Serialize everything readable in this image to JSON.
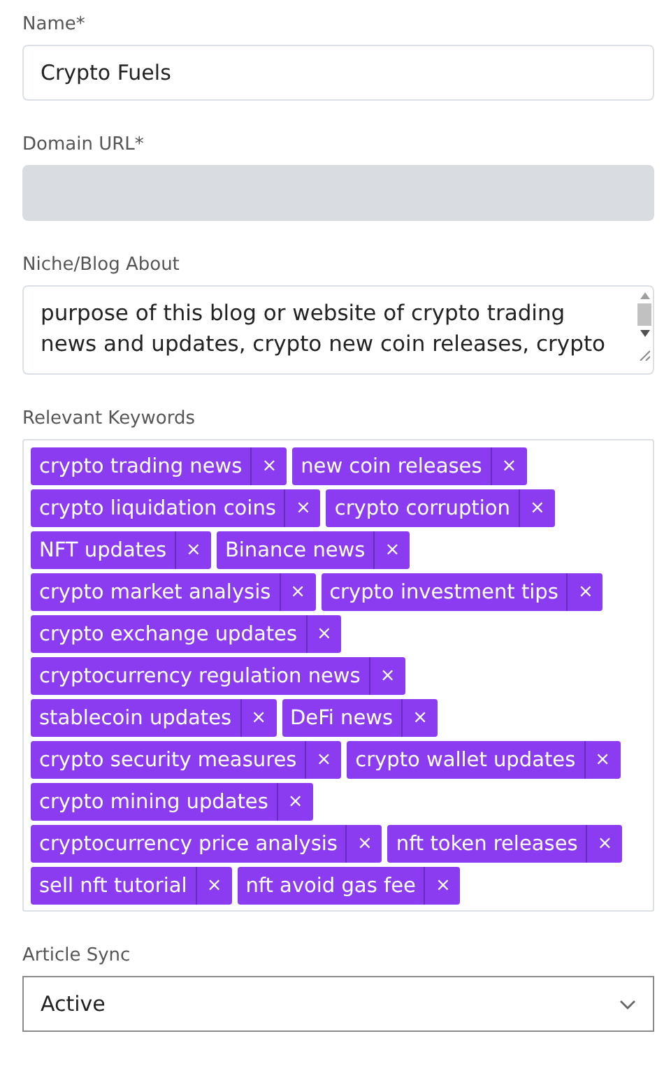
{
  "fields": [
    {
      "kind": "input",
      "label": "Name*",
      "value": "Crypto Fuels",
      "disabled": false
    },
    {
      "kind": "input",
      "label": "Domain URL*",
      "disabled": true
    },
    {
      "kind": "textarea",
      "label": "Niche/Blog About",
      "value": "purpose of this blog or website of crypto trading news and updates, crypto new coin releases, crypto"
    },
    {
      "kind": "tags",
      "label": "Relevant Keywords",
      "tags": [
        {
          "text": "crypto trading news",
          "remove": "×"
        },
        {
          "text": "new coin releases",
          "remove": "×"
        },
        {
          "text": "crypto liquidation coins",
          "remove": "×"
        },
        {
          "text": "crypto corruption",
          "remove": "×"
        },
        {
          "text": "NFT updates",
          "remove": "×"
        },
        {
          "text": "Binance news",
          "remove": "×"
        },
        {
          "text": "crypto market analysis",
          "remove": "×"
        },
        {
          "text": "crypto investment tips",
          "remove": "×"
        },
        {
          "text": "crypto exchange updates",
          "remove": "×"
        },
        {
          "text": "cryptocurrency regulation news",
          "remove": "×"
        },
        {
          "text": "stablecoin updates",
          "remove": "×"
        },
        {
          "text": "DeFi news",
          "remove": "×"
        },
        {
          "text": "crypto security measures",
          "remove": "×"
        },
        {
          "text": "crypto wallet updates",
          "remove": "×"
        },
        {
          "text": "crypto mining updates",
          "remove": "×"
        },
        {
          "text": "cryptocurrency price analysis",
          "remove": "×"
        },
        {
          "text": "nft token releases",
          "remove": "×"
        },
        {
          "text": "sell nft tutorial",
          "remove": "×"
        },
        {
          "text": "nft avoid gas fee",
          "remove": "×"
        }
      ]
    },
    {
      "kind": "select",
      "label": "Article Sync",
      "value": "Active"
    }
  ]
}
